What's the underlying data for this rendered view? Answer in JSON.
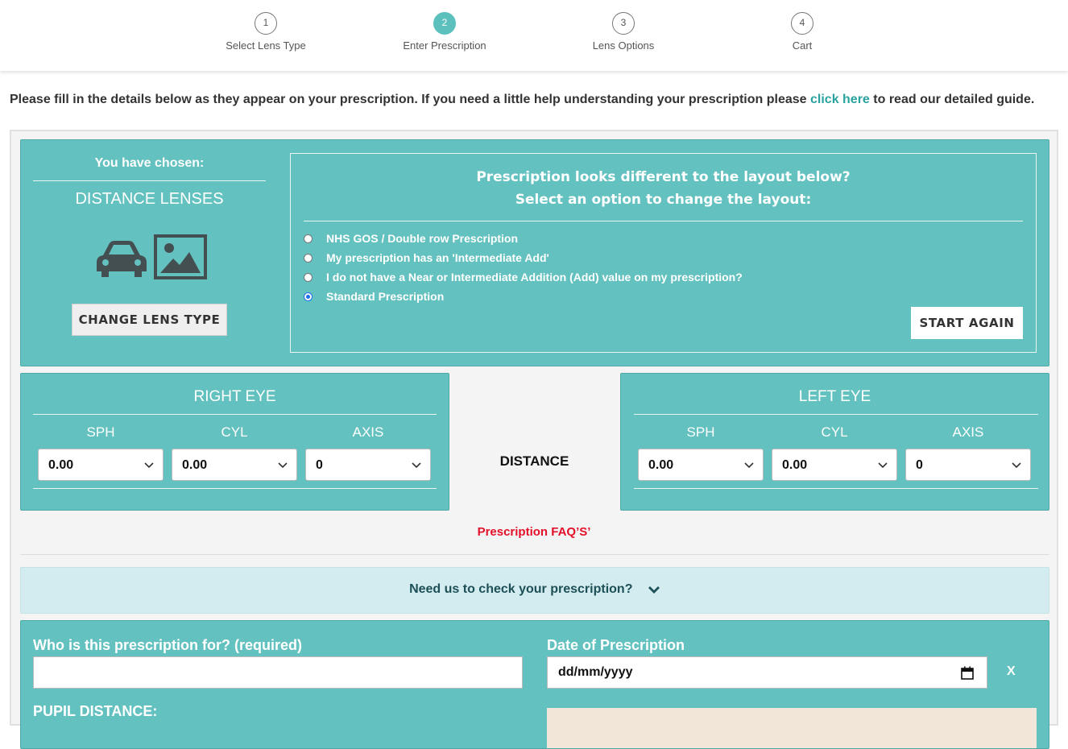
{
  "steps": [
    {
      "num": "1",
      "label": "Select Lens Type"
    },
    {
      "num": "2",
      "label": "Enter Prescription"
    },
    {
      "num": "3",
      "label": "Lens Options"
    },
    {
      "num": "4",
      "label": "Cart"
    }
  ],
  "active_step": "2",
  "intro": {
    "before": "Please fill in the details below as they appear on your prescription. If you need a little help understanding your prescription please ",
    "link": "click here",
    "after": " to read our detailed guide."
  },
  "chosen": {
    "title": "You have chosen:",
    "lens_type": "DISTANCE LENSES",
    "icons": [
      "car-icon",
      "image-icon"
    ],
    "change_button": "CHANGE LENS TYPE"
  },
  "layout": {
    "title_line1": "Prescription looks different to the layout below?",
    "title_line2": "Select an option to change the layout:",
    "options": [
      {
        "label": "NHS GOS / Double row Prescription",
        "checked": false
      },
      {
        "label": "My prescription has an 'Intermediate Add'",
        "checked": false
      },
      {
        "label": "I do not have a Near or Intermediate Addition (Add) value on my prescription?",
        "checked": false
      },
      {
        "label": "Standard Prescription",
        "checked": true
      }
    ],
    "start_again": "START AGAIN"
  },
  "right_eye": {
    "title": "RIGHT EYE",
    "columns": [
      "SPH",
      "CYL",
      "AXIS"
    ],
    "values": [
      "0.00",
      "0.00",
      "0"
    ]
  },
  "left_eye": {
    "title": "LEFT EYE",
    "columns": [
      "SPH",
      "CYL",
      "AXIS"
    ],
    "values": [
      "0.00",
      "0.00",
      "0"
    ]
  },
  "distance_label": "DISTANCE",
  "faq_link": "Prescription FAQ’S’",
  "check_bar": {
    "label": "Need us to check your prescription?"
  },
  "form": {
    "who_label": "Who is this prescription for? (required)",
    "who_value": "",
    "date_label": "Date of Prescription",
    "date_placeholder": "dd/mm/yyyy",
    "clear_label": "X",
    "pupil_label": "PUPIL DISTANCE:"
  },
  "colors": {
    "teal_panel": "#63c1bf",
    "teal_active": "#5cc0bd",
    "link": "#2aa3a0",
    "faq_red": "#e3102a",
    "check_bar_bg": "#d2ecef"
  }
}
